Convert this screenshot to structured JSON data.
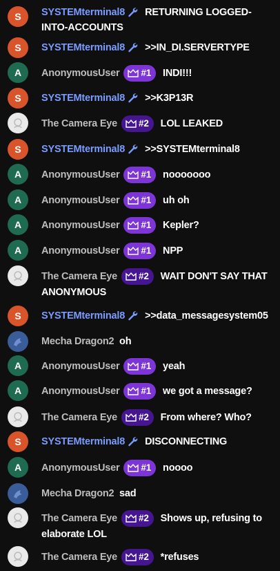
{
  "users": {
    "system": {
      "name": "SYSTEMterminal8",
      "avatar_letter": "S",
      "color": "#7a9cff",
      "avatar_color": "#d8542b"
    },
    "anon": {
      "name": "AnonymousUser",
      "avatar_letter": "A",
      "avatar_color": "#1f6b51",
      "badge": "#1"
    },
    "camera": {
      "name": "The Camera Eye",
      "badge": "#2"
    },
    "dragon": {
      "name": "Mecha Dragon2"
    }
  },
  "messages": [
    {
      "author": "system",
      "text": "RETURNING LOGGED-INTO-ACCOUNTS"
    },
    {
      "author": "system",
      "text": ">>IN_DI.SERVERTYPE"
    },
    {
      "author": "anon",
      "text": "INDI!!!"
    },
    {
      "author": "system",
      "text": ">>K3P13R"
    },
    {
      "author": "camera",
      "text": "LOL LEAKED"
    },
    {
      "author": "system",
      "text": ">>SYSTEMterminal8"
    },
    {
      "author": "anon",
      "text": "nooooooo"
    },
    {
      "author": "anon",
      "text": "uh oh"
    },
    {
      "author": "anon",
      "text": "Kepler?"
    },
    {
      "author": "anon",
      "text": "NPP"
    },
    {
      "author": "camera",
      "text": "WAIT DON'T SAY THAT ANONYMOUS"
    },
    {
      "author": "system",
      "text": ">>data_messagesystem05"
    },
    {
      "author": "dragon",
      "text": "oh"
    },
    {
      "author": "anon",
      "text": "yeah"
    },
    {
      "author": "anon",
      "text": "we got a message?"
    },
    {
      "author": "camera",
      "text": "From where? Who?"
    },
    {
      "author": "system",
      "text": "DISCONNECTING"
    },
    {
      "author": "anon",
      "text": "noooo"
    },
    {
      "author": "dragon",
      "text": "sad"
    },
    {
      "author": "camera",
      "text": "Shows up, refusing to elaborate LOL"
    },
    {
      "author": "camera",
      "text": "*refuses"
    }
  ]
}
